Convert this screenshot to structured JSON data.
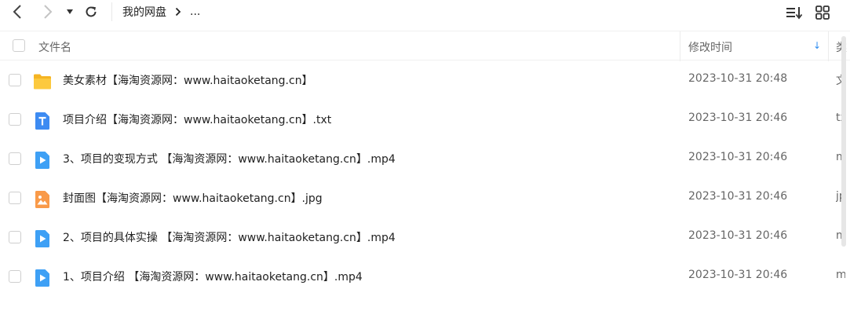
{
  "toolbar": {
    "back_icon": "chevron-left-icon",
    "forward_icon": "chevron-right-icon",
    "dropdown_icon": "caret-down-icon",
    "refresh_icon": "refresh-icon",
    "breadcrumb": {
      "root": "我的网盘",
      "separator_icon": "chevron-right-icon",
      "ellipsis": "..."
    },
    "sort_icon": "sort-list-icon",
    "grid_icon": "grid-view-icon"
  },
  "header": {
    "name_label": "文件名",
    "time_label": "修改时间",
    "type_label": "类",
    "sort_indicator": "↓"
  },
  "colors": {
    "accent": "#2d8cf0",
    "folder": "#f9c23c",
    "doc": "#3d8bf2",
    "video": "#3ea0f5",
    "image": "#f99a49"
  },
  "files": [
    {
      "icon": "folder-icon",
      "name": "美女素材【海淘资源网：www.haitaoketang.cn】",
      "modified": "2023-10-31 20:48",
      "type": "文"
    },
    {
      "icon": "txt-file-icon",
      "name": "项目介绍【海淘资源网：www.haitaoketang.cn】.txt",
      "modified": "2023-10-31 20:46",
      "type": "tx"
    },
    {
      "icon": "video-file-icon",
      "name": "3、项目的变现方式 【海淘资源网：www.haitaoketang.cn】.mp4",
      "modified": "2023-10-31 20:46",
      "type": "m"
    },
    {
      "icon": "image-file-icon",
      "name": "封面图【海淘资源网：www.haitaoketang.cn】.jpg",
      "modified": "2023-10-31 20:46",
      "type": "jp"
    },
    {
      "icon": "video-file-icon",
      "name": "2、项目的具体实操 【海淘资源网：www.haitaoketang.cn】.mp4",
      "modified": "2023-10-31 20:46",
      "type": "m"
    },
    {
      "icon": "video-file-icon",
      "name": "1、项目介绍 【海淘资源网：www.haitaoketang.cn】.mp4",
      "modified": "2023-10-31 20:46",
      "type": "m"
    }
  ]
}
